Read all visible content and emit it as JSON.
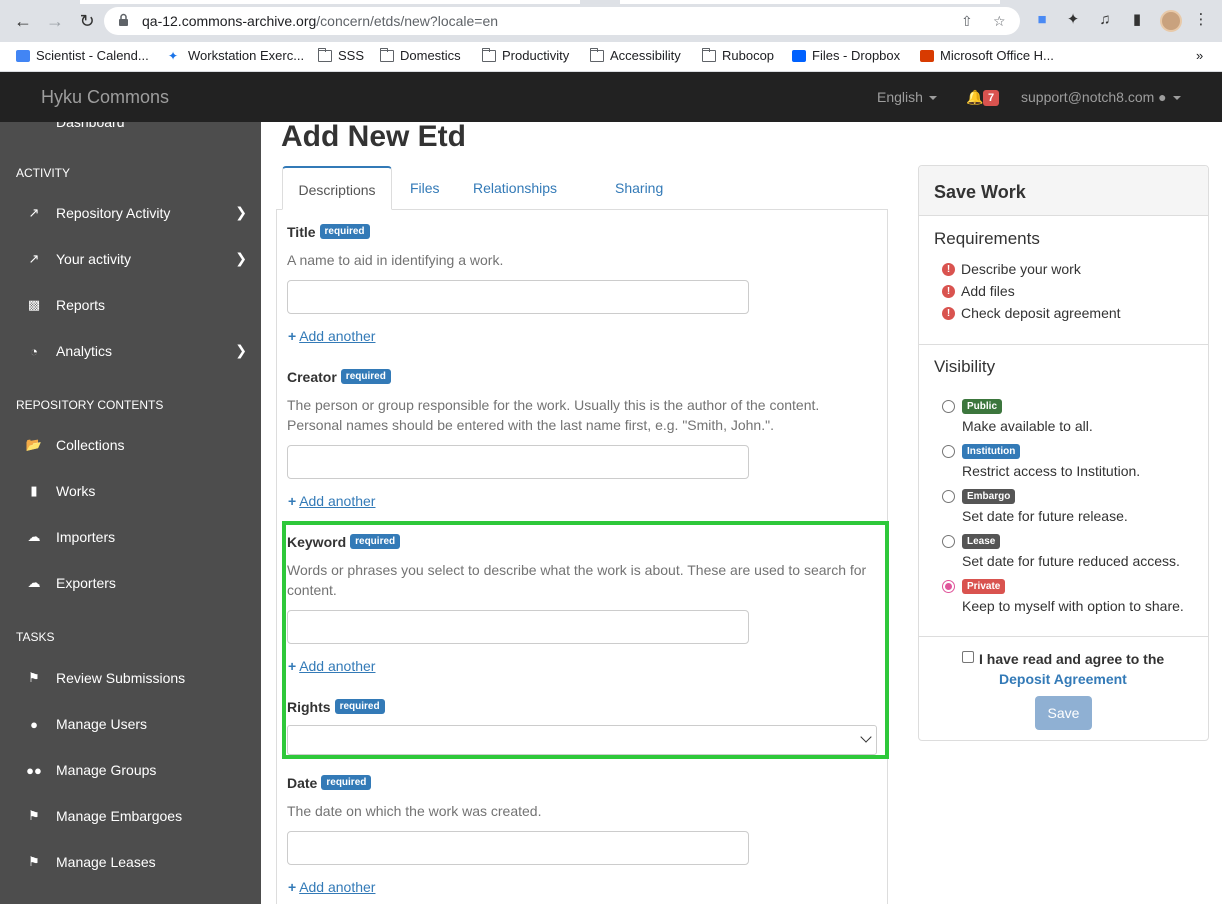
{
  "browser": {
    "url_host": "qa-12.commons-archive.org",
    "url_path": "/concern/etds/new?locale=en",
    "bookmarks": [
      {
        "label": "Scientist - Calend...",
        "icon": "calendar-icon"
      },
      {
        "label": "Workstation Exerc...",
        "icon": "bird-icon"
      },
      {
        "label": "SSS",
        "icon": "folder-icon"
      },
      {
        "label": "Domestics",
        "icon": "folder-icon"
      },
      {
        "label": "Productivity",
        "icon": "folder-icon"
      },
      {
        "label": "Accessibility",
        "icon": "folder-icon"
      },
      {
        "label": "Rubocop",
        "icon": "folder-icon"
      },
      {
        "label": "Files - Dropbox",
        "icon": "dropbox-icon"
      },
      {
        "label": "Microsoft Office H...",
        "icon": "office-icon"
      }
    ],
    "more_bookmarks": "»"
  },
  "navbar": {
    "brand": "Hyku Commons",
    "language": "English",
    "notification_count": "7",
    "user": "support@notch8.com"
  },
  "sidebar": {
    "cut_item": "Dashboard",
    "sections": {
      "activity": "ACTIVITY",
      "repository_contents": "REPOSITORY CONTENTS",
      "tasks": "TASKS"
    },
    "activity_items": [
      {
        "label": "Repository Activity",
        "icon": "line-chart-icon",
        "has_chevron": true
      },
      {
        "label": "Your activity",
        "icon": "line-chart-icon",
        "has_chevron": true
      },
      {
        "label": "Reports",
        "icon": "bar-chart-icon",
        "has_chevron": false
      },
      {
        "label": "Analytics",
        "icon": "pie-chart-icon",
        "has_chevron": true
      }
    ],
    "content_items": [
      {
        "label": "Collections",
        "icon": "folder-open-icon"
      },
      {
        "label": "Works",
        "icon": "file-icon"
      },
      {
        "label": "Importers",
        "icon": "cloud-upload-icon"
      },
      {
        "label": "Exporters",
        "icon": "cloud-download-icon"
      }
    ],
    "task_items": [
      {
        "label": "Review Submissions",
        "icon": "flag-icon"
      },
      {
        "label": "Manage Users",
        "icon": "user-icon"
      },
      {
        "label": "Manage Groups",
        "icon": "users-icon"
      },
      {
        "label": "Manage Embargoes",
        "icon": "flag-icon"
      },
      {
        "label": "Manage Leases",
        "icon": "flag-icon"
      }
    ]
  },
  "main": {
    "title": "Add New Etd",
    "tabs": [
      "Descriptions",
      "Files",
      "Relationships",
      "Sharing"
    ],
    "required_badge": "required",
    "add_another": "Add another",
    "fields": {
      "title": {
        "label": "Title",
        "help": "A name to aid in identifying a work.",
        "value": ""
      },
      "creator": {
        "label": "Creator",
        "help_line1": "The person or group responsible for the work. Usually this is the author of the content.",
        "help_line2": "Personal names should be entered with the last name first, e.g. \"Smith, John.\".",
        "value": ""
      },
      "keyword": {
        "label": "Keyword",
        "help_line1": "Words or phrases you select to describe what the work is about. These are used to search for",
        "help_line2": "content.",
        "value": ""
      },
      "rights": {
        "label": "Rights",
        "selected": ""
      },
      "date": {
        "label": "Date",
        "help": "The date on which the work was created.",
        "value": ""
      }
    }
  },
  "save_panel": {
    "title": "Save Work",
    "requirements_heading": "Requirements",
    "requirements": [
      "Describe your work",
      "Add files",
      "Check deposit agreement"
    ],
    "visibility_heading": "Visibility",
    "visibility_options": [
      {
        "badge": "Public",
        "desc": "Make available to all.",
        "color": "#3c763d",
        "checked": false
      },
      {
        "badge": "Institution",
        "desc": "Restrict access to Institution.",
        "color": "#337ab7",
        "checked": false
      },
      {
        "badge": "Embargo",
        "desc": "Set date for future release.",
        "color": "#555555",
        "checked": false
      },
      {
        "badge": "Lease",
        "desc": "Set date for future reduced access.",
        "color": "#555555",
        "checked": false
      },
      {
        "badge": "Private",
        "desc": "Keep to myself with option to share.",
        "color": "#d9534f",
        "checked": true
      }
    ],
    "agreement_text": "I have read and agree to the",
    "agreement_link": "Deposit Agreement",
    "save_button": "Save"
  }
}
